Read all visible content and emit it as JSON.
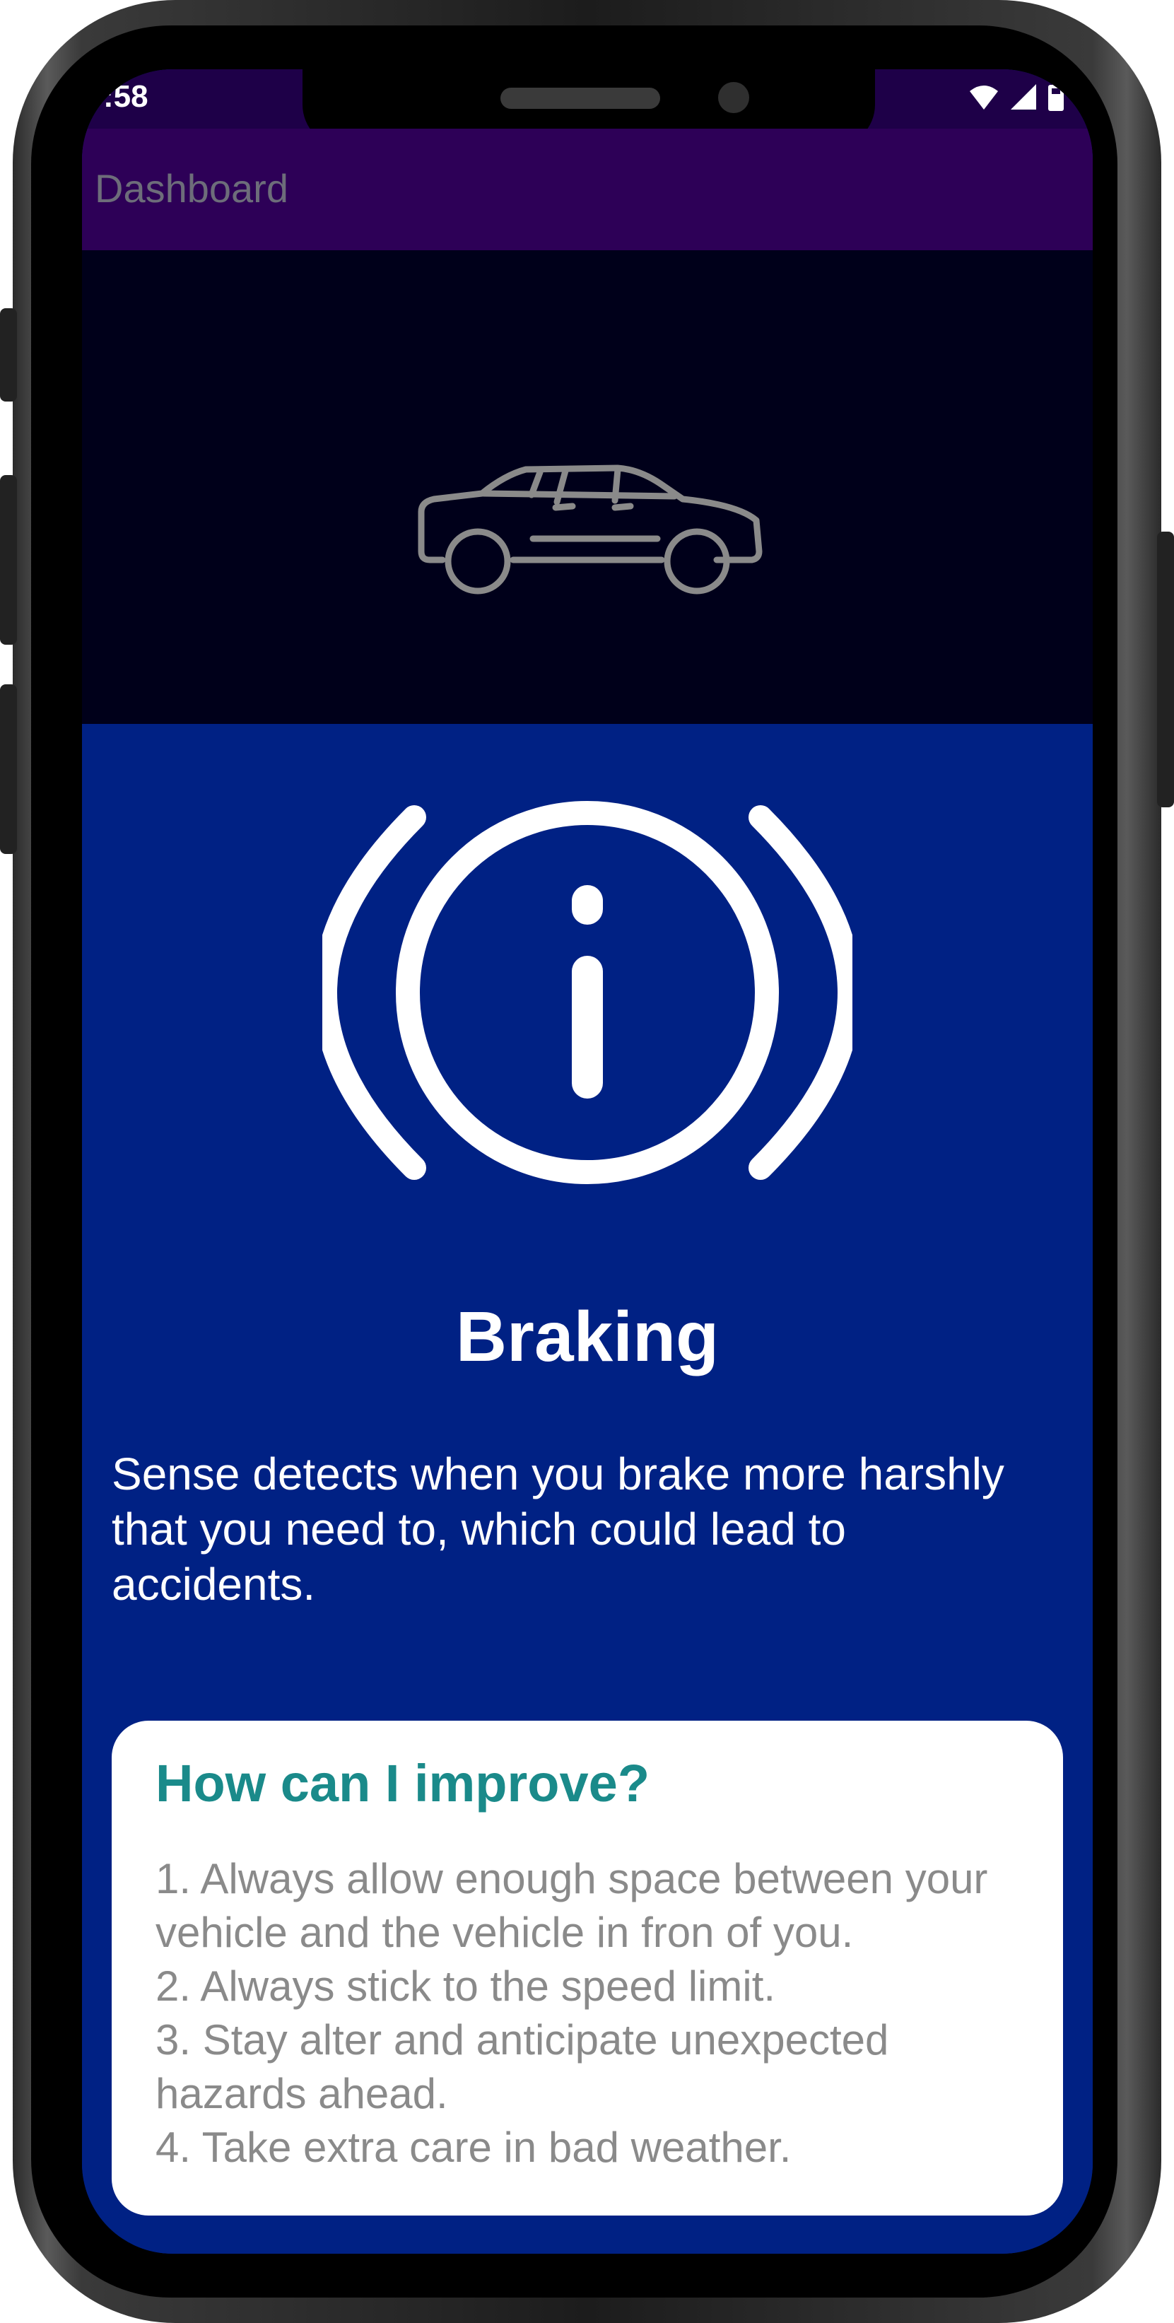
{
  "status_bar": {
    "time": ":58",
    "icons": [
      "wifi-icon",
      "signal-icon",
      "battery-icon"
    ]
  },
  "app_bar": {
    "title": "Dashboard"
  },
  "hero": {
    "icon": "car-icon"
  },
  "content": {
    "icon": "brake-warning-icon",
    "title": "Braking",
    "description": "Sense detects when you brake more harshly that you need to, which could lead to accidents."
  },
  "tips_card": {
    "title": "How can I improve?",
    "items": [
      "1. Always allow enough space between your vehicle and the vehicle in fron of you.",
      "2. Always stick to the speed limit.",
      "3. Stay alter and anticipate unexpected hazards ahead.",
      "4. Take extra care in bad weather."
    ]
  },
  "colors": {
    "status_bar": "#1e0048",
    "app_bar": "#2d0057",
    "hero_background": "#00001a",
    "content_background": "#002184",
    "accent": "#1a8a8a",
    "tip_text": "#8a8a8a"
  }
}
